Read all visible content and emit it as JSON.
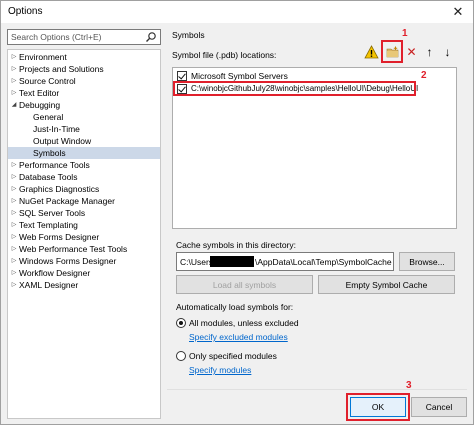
{
  "window": {
    "title": "Options",
    "close_glyph": "✕"
  },
  "search": {
    "placeholder": "Search Options (Ctrl+E)"
  },
  "tree": [
    {
      "label": "Environment",
      "arrow": "▷",
      "level": 0
    },
    {
      "label": "Projects and Solutions",
      "arrow": "▷",
      "level": 0
    },
    {
      "label": "Source Control",
      "arrow": "▷",
      "level": 0
    },
    {
      "label": "Text Editor",
      "arrow": "▷",
      "level": 0
    },
    {
      "label": "Debugging",
      "arrow": "◢",
      "level": 0
    },
    {
      "label": "General",
      "arrow": "",
      "level": 1
    },
    {
      "label": "Just-In-Time",
      "arrow": "",
      "level": 1
    },
    {
      "label": "Output Window",
      "arrow": "",
      "level": 1
    },
    {
      "label": "Symbols",
      "arrow": "",
      "level": 1,
      "selected": true
    },
    {
      "label": "Performance Tools",
      "arrow": "▷",
      "level": 0
    },
    {
      "label": "Database Tools",
      "arrow": "▷",
      "level": 0
    },
    {
      "label": "Graphics Diagnostics",
      "arrow": "▷",
      "level": 0
    },
    {
      "label": "NuGet Package Manager",
      "arrow": "▷",
      "level": 0
    },
    {
      "label": "SQL Server Tools",
      "arrow": "▷",
      "level": 0
    },
    {
      "label": "Text Templating",
      "arrow": "▷",
      "level": 0
    },
    {
      "label": "Web Forms Designer",
      "arrow": "▷",
      "level": 0
    },
    {
      "label": "Web Performance Test Tools",
      "arrow": "▷",
      "level": 0
    },
    {
      "label": "Windows Forms Designer",
      "arrow": "▷",
      "level": 0
    },
    {
      "label": "Workflow Designer",
      "arrow": "▷",
      "level": 0
    },
    {
      "label": "XAML Designer",
      "arrow": "▷",
      "level": 0
    }
  ],
  "symbols": {
    "section_title": "Symbols",
    "locations_label": "Symbol file (.pdb) locations:",
    "toolbar": {
      "warning_icon": "warning-icon",
      "add_icon": "add-folder-icon",
      "delete_glyph": "✕",
      "up_glyph": "↑",
      "down_glyph": "↓"
    },
    "locations": [
      {
        "label": "Microsoft Symbol Servers",
        "checked": true
      },
      {
        "label": "C:\\winobjcGithubJuly28\\winobjc\\samples\\HelloUI\\Debug\\HelloUI",
        "checked": true
      }
    ],
    "cache_label": "Cache symbols in this directory:",
    "cache_prefix": "C:\\Users\\",
    "cache_suffix": "\\AppData\\Local\\Temp\\SymbolCache",
    "browse_label": "Browse...",
    "load_all_label": "Load all symbols",
    "empty_cache_label": "Empty Symbol Cache",
    "auto_load_label": "Automatically load symbols for:",
    "opt_all": "All modules, unless excluded",
    "link_excluded": "Specify excluded modules",
    "opt_specified": "Only specified modules",
    "link_specified": "Specify modules"
  },
  "callouts": {
    "one": "1",
    "two": "2",
    "three": "3"
  },
  "footer": {
    "ok_label": "OK",
    "cancel_label": "Cancel"
  },
  "colors": {
    "callout": "#e0202c",
    "link": "#0066cc",
    "selection": "#ccd8e8",
    "warning": "#f5c400"
  }
}
